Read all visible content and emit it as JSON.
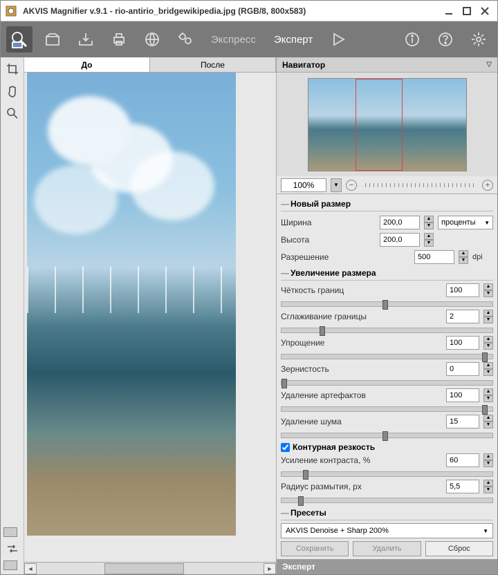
{
  "titlebar": {
    "title": "AKVIS Magnifier v.9.1 - rio-antirio_bridgewikipedia.jpg (RGB/8, 800x583)"
  },
  "toolbar": {
    "mode_express": "Экспресс",
    "mode_expert": "Эксперт"
  },
  "tabs": {
    "before": "До",
    "after": "После"
  },
  "navigator": {
    "title": "Навигатор",
    "zoom": "100%"
  },
  "newsize": {
    "title": "Новый размер",
    "width_label": "Ширина",
    "width_value": "200,0",
    "height_label": "Высота",
    "height_value": "200,0",
    "res_label": "Разрешение",
    "res_value": "500",
    "units": "проценты",
    "dpi": "dpi"
  },
  "enlarge": {
    "title": "Увеличение размера",
    "edge_sharpness_label": "Чёткость границ",
    "edge_sharpness_value": "100",
    "edge_smooth_label": "Сглаживание границы",
    "edge_smooth_value": "2",
    "simplify_label": "Упрощение",
    "simplify_value": "100",
    "grain_label": "Зернистость",
    "grain_value": "0",
    "artifact_label": "Удаление артефактов",
    "artifact_value": "100",
    "noise_label": "Удаление шума",
    "noise_value": "15"
  },
  "unsharp": {
    "title": "Контурная резкость",
    "contrast_label": "Усиление контраста, %",
    "contrast_value": "60",
    "radius_label": "Радиус размытия, px",
    "radius_value": "5,5"
  },
  "presets": {
    "title": "Пресеты",
    "selected": "AKVIS Denoise + Sharp 200%",
    "save": "Сохранить",
    "delete": "Удалить",
    "reset": "Сброс"
  },
  "footer": {
    "expert": "Эксперт"
  }
}
